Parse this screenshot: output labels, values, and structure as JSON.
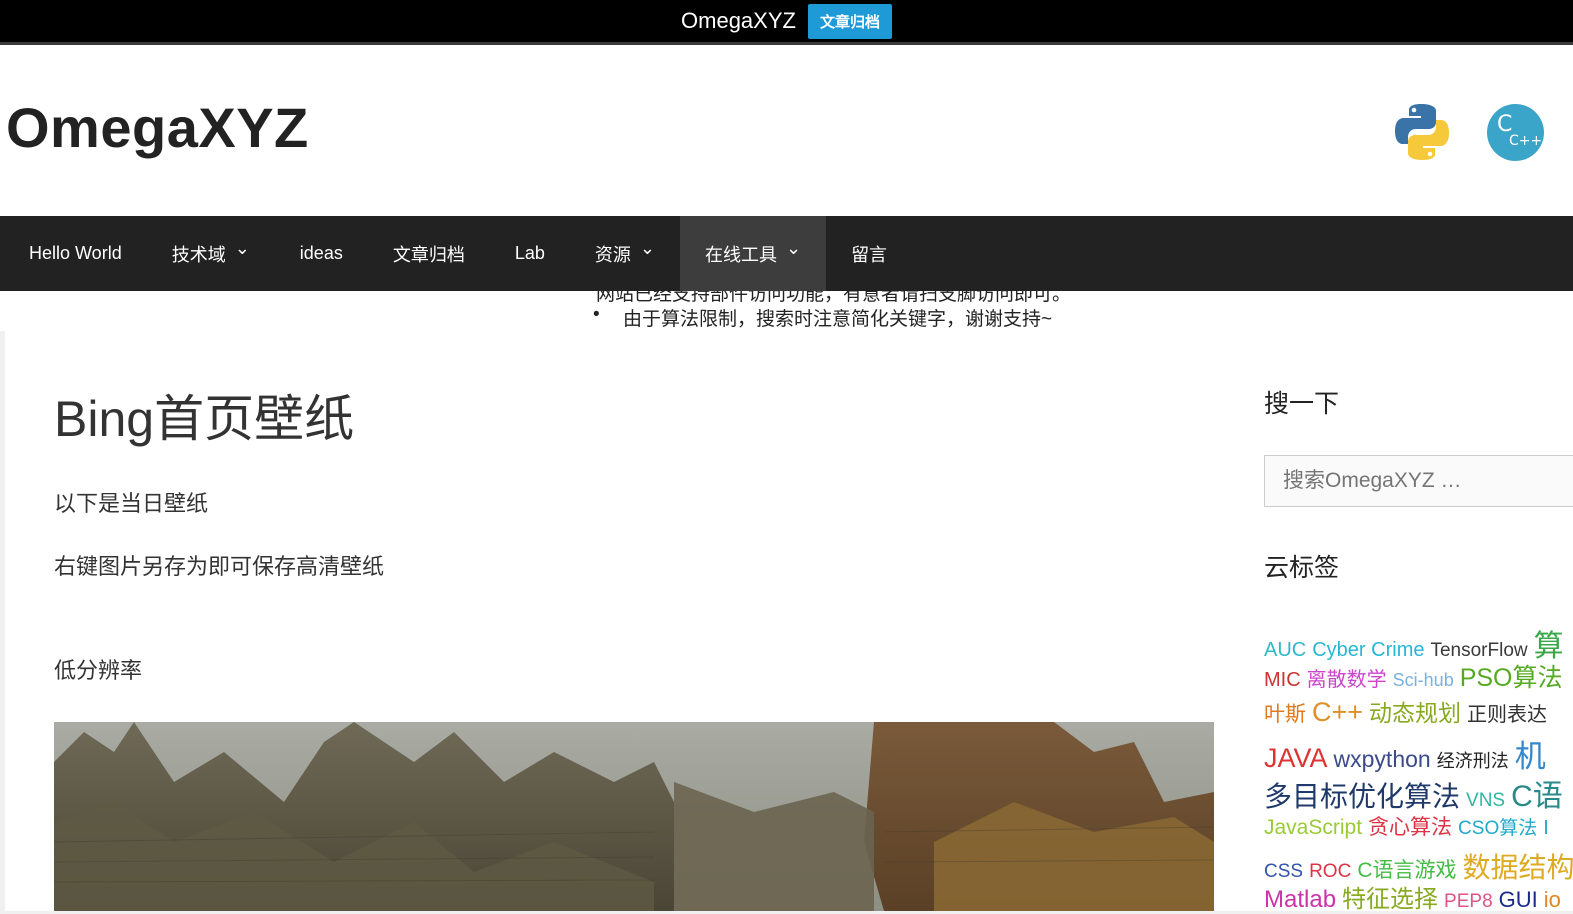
{
  "topbar": {
    "title": "OmegaXYZ",
    "badge": "文章归档"
  },
  "header": {
    "site_title": "OmegaXYZ"
  },
  "nav": {
    "items": [
      {
        "label": "Hello World",
        "dropdown": false
      },
      {
        "label": "技术域",
        "dropdown": true
      },
      {
        "label": "ideas",
        "dropdown": false
      },
      {
        "label": "文章归档",
        "dropdown": false
      },
      {
        "label": "Lab",
        "dropdown": false
      },
      {
        "label": "资源",
        "dropdown": true
      },
      {
        "label": "在线工具",
        "dropdown": true,
        "active": true
      },
      {
        "label": "留言",
        "dropdown": false
      }
    ]
  },
  "notice": {
    "line1": "网站已经支持部件访问功能，有意者请扫支脚访问即可。",
    "line2": "由于算法限制，搜索时注意简化关键字，谢谢支持~"
  },
  "article": {
    "title": "Bing首页壁纸",
    "p1": "以下是当日壁纸",
    "p2": "右键图片另存为即可保存高清壁纸",
    "p3": "低分辨率"
  },
  "sidebar": {
    "search_title": "搜一下",
    "search_placeholder": "搜索OmegaXYZ …",
    "tags_title": "云标签",
    "tag_rows": [
      [
        {
          "t": "AUC",
          "c": "#2eb8c9",
          "s": 20
        },
        {
          "t": "Cyber Crime",
          "c": "#27b7d6",
          "s": 20
        },
        {
          "t": "TensorFlow",
          "c": "#3a3a3a",
          "s": 19
        },
        {
          "t": "算",
          "c": "#3aa848",
          "s": 30
        }
      ],
      [
        {
          "t": "MIC",
          "c": "#cc3333",
          "s": 20
        },
        {
          "t": "离散数学",
          "c": "#cc44cc",
          "s": 20
        },
        {
          "t": "Sci-hub",
          "c": "#7ab0e0",
          "s": 18
        },
        {
          "t": "PSO算法",
          "c": "#55aa22",
          "s": 25
        }
      ],
      [
        {
          "t": "叶斯",
          "c": "#e07a20",
          "s": 21
        },
        {
          "t": "C++",
          "c": "#e0902a",
          "s": 27
        },
        {
          "t": "动态规划",
          "c": "#88aa22",
          "s": 23
        },
        {
          "t": "正则表达",
          "c": "#333333",
          "s": 20
        }
      ],
      [
        {
          "t": "JAVA",
          "c": "#dd3333",
          "s": 27
        },
        {
          "t": "wxpython",
          "c": "#3a4a8a",
          "s": 23
        },
        {
          "t": "经济刑法",
          "c": "#222222",
          "s": 18
        },
        {
          "t": "机",
          "c": "#3388cc",
          "s": 31
        }
      ],
      [
        {
          "t": "多目标优化算法",
          "c": "#1f3a6a",
          "s": 28
        },
        {
          "t": "VNS",
          "c": "#2eb8a0",
          "s": 19
        },
        {
          "t": "C语",
          "c": "#2a8a8a",
          "s": 30
        }
      ],
      [
        {
          "t": "JavaScript",
          "c": "#99cc33",
          "s": 21
        },
        {
          "t": "贪心算法",
          "c": "#dd3344",
          "s": 21
        },
        {
          "t": "CSO算法",
          "c": "#22aacc",
          "s": 19
        },
        {
          "t": "I",
          "c": "#22aacc",
          "s": 20
        }
      ],
      [
        {
          "t": "CSS",
          "c": "#3355aa",
          "s": 19
        },
        {
          "t": "ROC",
          "c": "#dd3344",
          "s": 19
        },
        {
          "t": "C语言游戏",
          "c": "#44bb44",
          "s": 21
        },
        {
          "t": "数据结构",
          "c": "#ddaa22",
          "s": 28
        }
      ],
      [
        {
          "t": "Matlab",
          "c": "#cc33aa",
          "s": 24
        },
        {
          "t": "特征选择",
          "c": "#88aa22",
          "s": 24
        },
        {
          "t": "PEP8",
          "c": "#dd5588",
          "s": 19
        },
        {
          "t": "GUI",
          "c": "#1a2a8a",
          "s": 22
        },
        {
          "t": "io",
          "c": "#dd8822",
          "s": 22
        }
      ]
    ]
  }
}
